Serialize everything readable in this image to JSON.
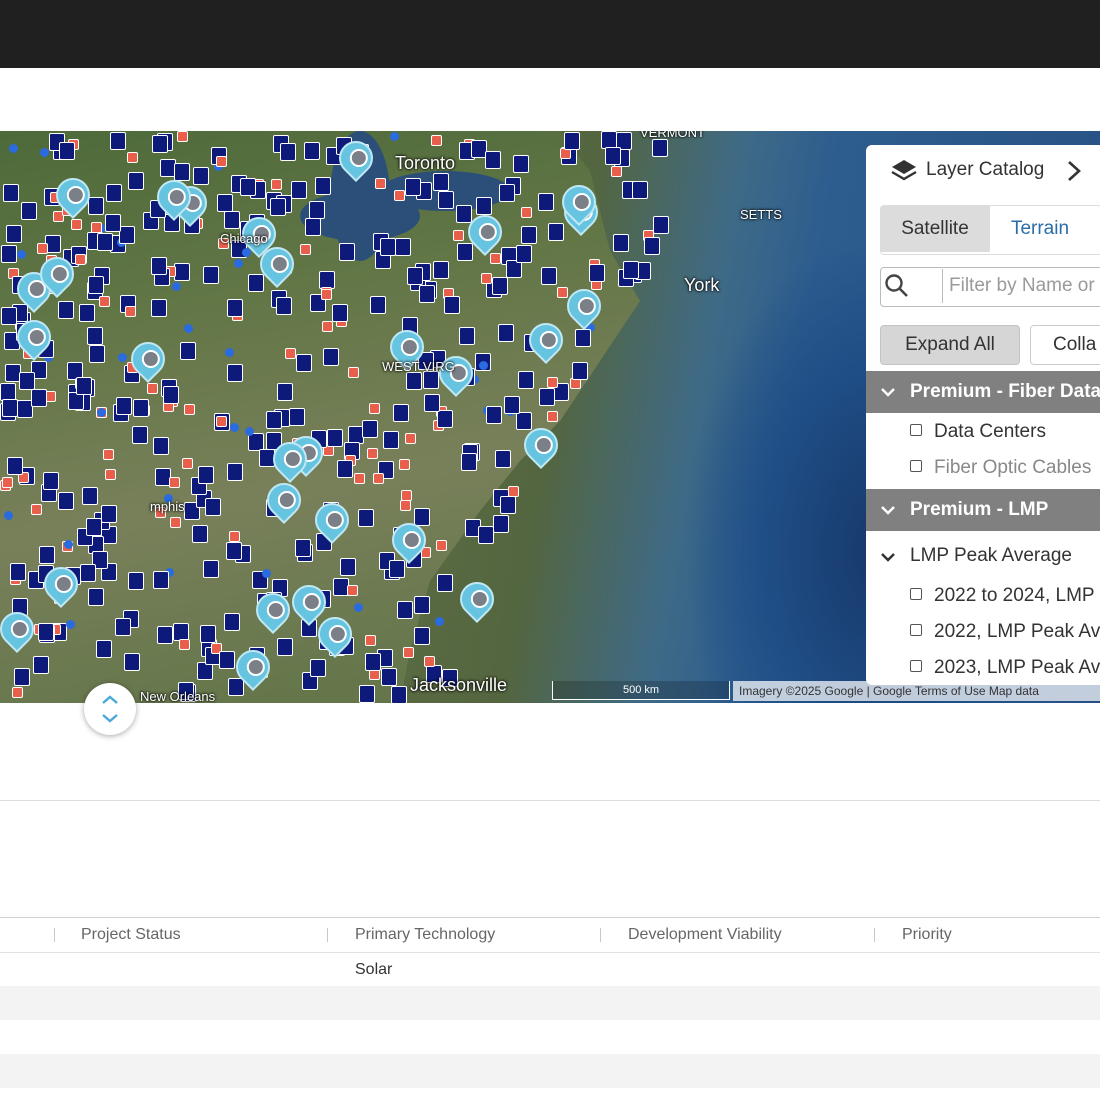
{
  "map": {
    "labels": {
      "toronto": "Toronto",
      "york": "York",
      "new_orleans": "New Orleans",
      "jacksonville": "Jacksonville",
      "chicago": "Chicago",
      "west_virginia": "WEST VIRG",
      "vermont": "VERMONT",
      "massachusetts": "SETTS",
      "memphis": "mphis"
    },
    "scale_label": "500 km",
    "attribution": "Imagery ©2025 Google | Google Terms of Use Map data"
  },
  "layer_catalog": {
    "title": "Layer Catalog",
    "basemap": {
      "satellite_label": "Satellite",
      "terrain_label": "Terrain",
      "selected": "Satellite"
    },
    "filter_placeholder": "Filter by Name or",
    "expand_all_label": "Expand All",
    "collapse_all_label": "Colla",
    "groups": [
      {
        "label": "Premium - Fiber Data",
        "items": [
          "Data Centers",
          "Fiber Optic Cables"
        ]
      },
      {
        "label": "Premium - LMP",
        "subgroups": [
          {
            "label": "LMP Peak Average",
            "items": [
              "2022 to 2024, LMP",
              "2022, LMP Peak Av",
              "2023, LMP Peak Av"
            ]
          }
        ]
      }
    ]
  },
  "table": {
    "columns": [
      "Project Status",
      "Primary Technology",
      "Development Viability",
      "Priority"
    ],
    "rows": [
      {
        "project_status": "",
        "primary_technology": "Solar",
        "development_viability": "",
        "priority": ""
      }
    ]
  },
  "colors": {
    "marker_navy": "#0d1a7a",
    "marker_red": "#e8604c",
    "pin_cyan": "#66c4e0",
    "terrain_link": "#2a6ca8"
  }
}
